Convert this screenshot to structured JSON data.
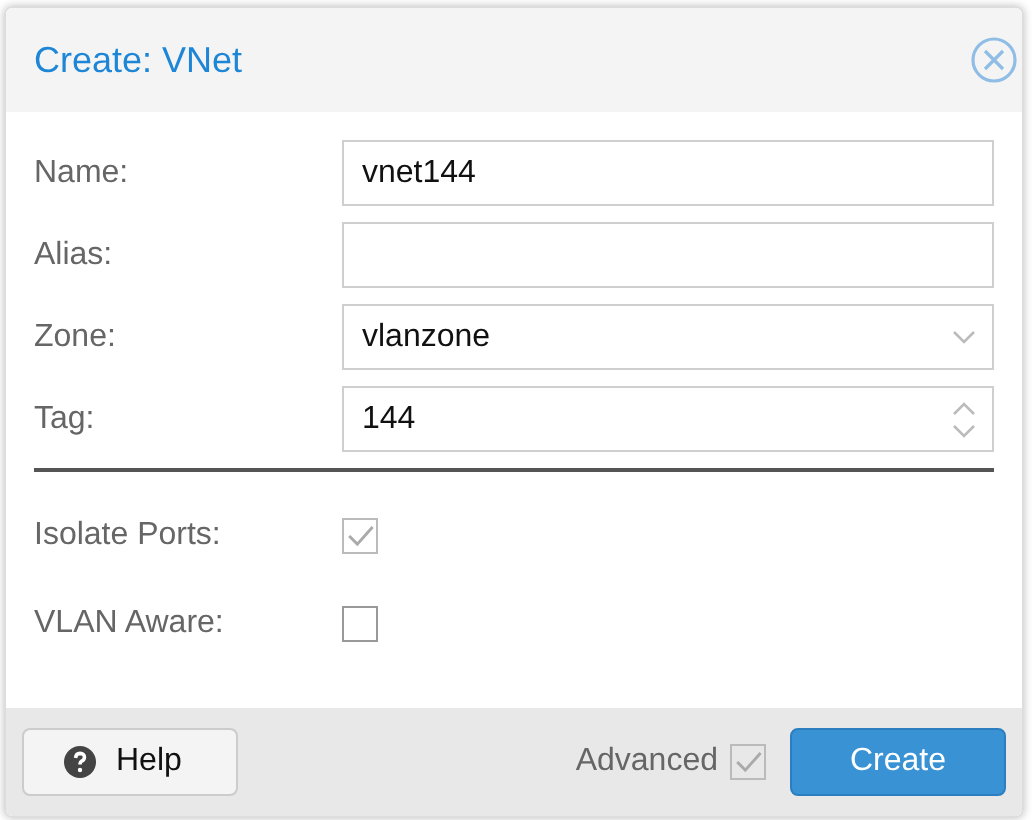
{
  "window": {
    "title": "Create: VNet"
  },
  "fields": [
    {
      "kind": "text",
      "label": "Name:",
      "value": "vnet144"
    },
    {
      "kind": "text",
      "label": "Alias:"
    },
    {
      "kind": "combo",
      "label": "Zone:",
      "value": "vlanzone"
    },
    {
      "kind": "number",
      "label": "Tag:",
      "value": "144"
    }
  ],
  "checkboxes": [
    {
      "label": "Isolate Ports:",
      "checked": true,
      "disabled": true
    },
    {
      "label": "VLAN Aware:",
      "checked": false,
      "disabled": false
    }
  ],
  "footer": {
    "help": "Help",
    "advanced": {
      "label": "Advanced",
      "checked": true
    },
    "submit": "Create"
  }
}
